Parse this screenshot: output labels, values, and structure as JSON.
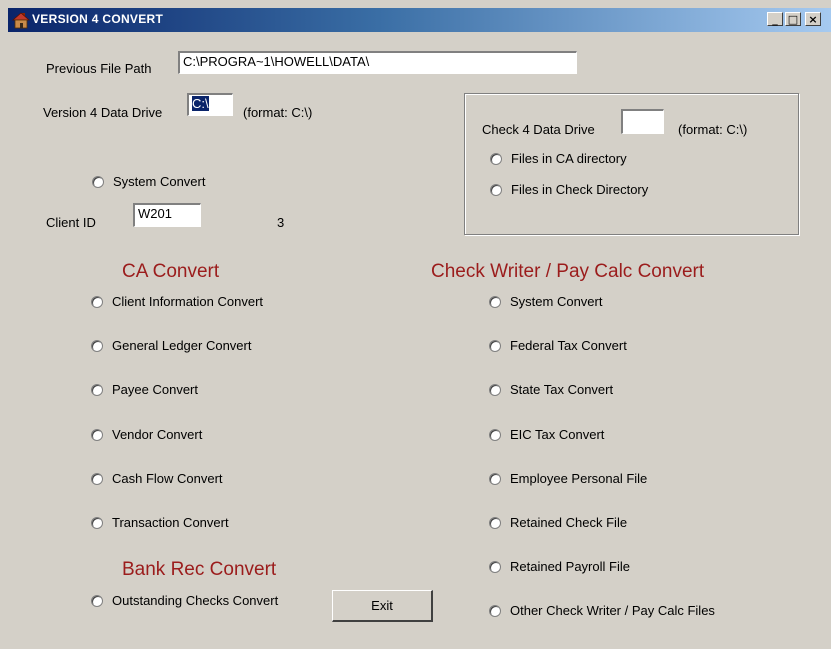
{
  "window": {
    "title": "VERSION 4 CONVERT",
    "controls": {
      "minimize": "_",
      "maximize": "□",
      "close": "×"
    }
  },
  "paths": {
    "previous_file_path_label": "Previous File Path",
    "previous_file_path_value": "C:\\PROGRA~1\\HOWELL\\DATA\\",
    "v4_drive_label": "Version 4 Data Drive",
    "v4_drive_value": "C:\\",
    "v4_format_hint": "(format: C:\\)"
  },
  "check4": {
    "drive_label": "Check 4 Data Drive",
    "drive_value": "",
    "format_hint": "(format: C:\\)",
    "files_in_ca": "Files in CA directory",
    "files_in_check": "Files in Check Directory"
  },
  "system_convert_label": "System Convert",
  "client": {
    "label": "Client ID",
    "value": "W201",
    "count": "3"
  },
  "ca": {
    "header": "CA Convert",
    "items": [
      "Client Information Convert",
      "General Ledger Convert",
      "Payee Convert",
      "Vendor Convert",
      "Cash Flow Convert",
      "Transaction Convert"
    ]
  },
  "bank_rec": {
    "header": "Bank Rec Convert",
    "outstanding_checks": "Outstanding Checks Convert"
  },
  "check_writer": {
    "header": "Check Writer / Pay Calc Convert",
    "items": [
      "System Convert",
      "Federal Tax Convert",
      "State Tax Convert",
      "EIC Tax Convert",
      "Employee Personal File",
      "Retained Check File",
      "Retained Payroll File",
      "Other Check Writer / Pay Calc Files"
    ]
  },
  "exit_label": "Exit",
  "colors": {
    "window_bg": "#d4d0c8",
    "header_red": "#9b1c1c",
    "title_gradient_start": "#0a246a",
    "title_gradient_end": "#a6caf0"
  }
}
